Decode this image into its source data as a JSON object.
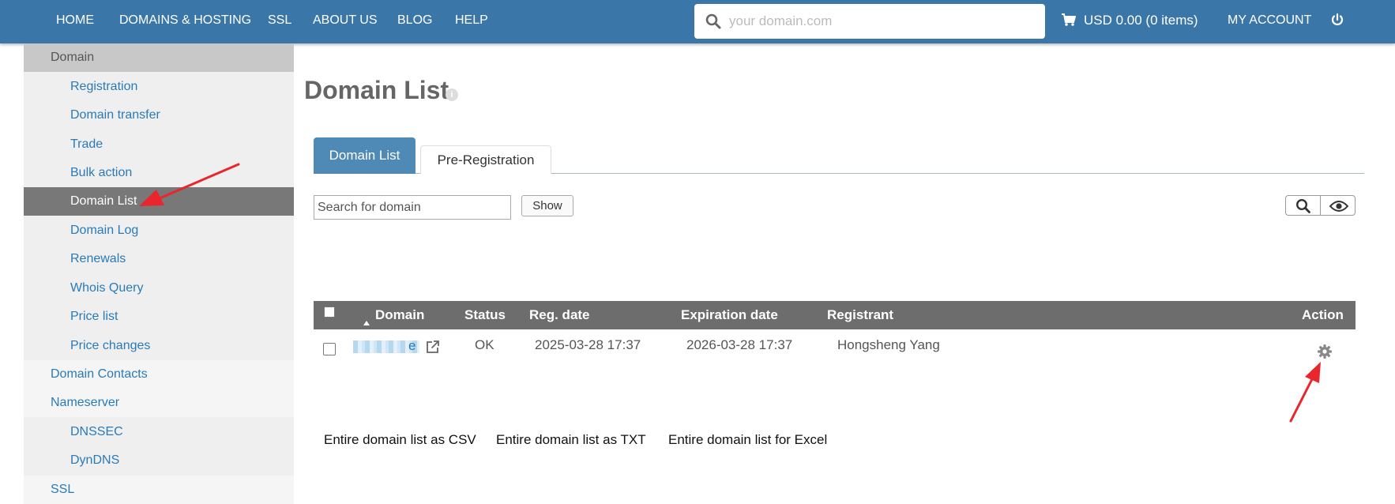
{
  "nav": {
    "items": [
      "HOME",
      "DOMAINS & HOSTING",
      "SSL",
      "ABOUT US",
      "BLOG",
      "HELP"
    ],
    "search_placeholder": "your domain.com",
    "cart": "USD 0.00 (0 items)",
    "account": "MY ACCOUNT"
  },
  "sidebar": {
    "header": "Domain",
    "sub_items": [
      "Registration",
      "Domain transfer",
      "Trade",
      "Bulk action",
      "Domain List",
      "Domain Log",
      "Renewals",
      "Whois Query",
      "Price list",
      "Price changes"
    ],
    "domain_contacts": "Domain Contacts",
    "nameserver": "Nameserver",
    "nameserver_items": [
      "DNSSEC",
      "DynDNS"
    ],
    "ssl": "SSL"
  },
  "page": {
    "title": "Domain List",
    "tabs": [
      "Domain List",
      "Pre-Registration"
    ],
    "search_placeholder": "Search for domain",
    "show_label": "Show"
  },
  "table": {
    "columns": [
      "Domain",
      "Status",
      "Reg. date",
      "Expiration date",
      "Registrant",
      "Action"
    ],
    "rows": [
      {
        "domain_tail": "e",
        "status": "OK",
        "reg_date": "2025-03-28 17:37",
        "expiration_date": "2026-03-28 17:37",
        "registrant": "Hongsheng Yang"
      }
    ]
  },
  "exports": [
    "Entire domain list as CSV",
    "Entire domain list as TXT",
    "Entire domain list for Excel"
  ],
  "colors": {
    "navbar": "#3a77a8",
    "tab_active": "#4f8ab7",
    "link": "#2b7ab8",
    "annotation_arrow": "#e8262b"
  },
  "icons": [
    "search-icon",
    "cart-icon",
    "power-icon",
    "info-icon",
    "search-tool-icon",
    "eye-icon",
    "sort-asc-icon",
    "external-link-icon",
    "gear-icon"
  ]
}
